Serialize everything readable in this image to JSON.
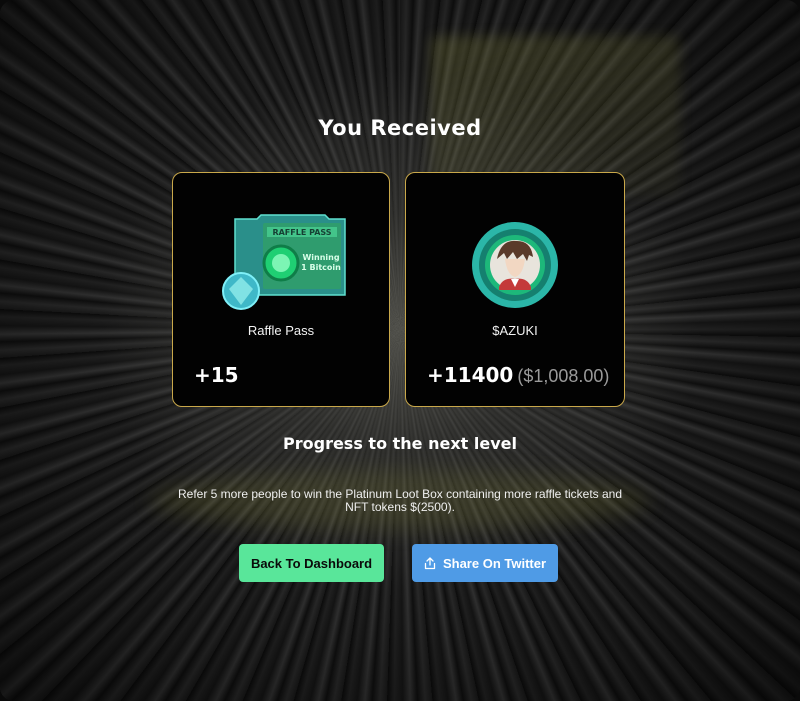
{
  "modal": {
    "title": "You Received"
  },
  "rewards": [
    {
      "icon": "raffle-pass-ticket",
      "ticket_text": {
        "heading": "RAFFLE PASS",
        "line1": "Winning",
        "line2": "1 Bitcoin"
      },
      "label": "Raffle Pass",
      "amount": "+15"
    },
    {
      "icon": "azuki-coin-avatar",
      "label": "$AZUKI",
      "amount": "+11400",
      "usd_value": "($1,008.00)"
    }
  ],
  "progress": {
    "title": "Progress to the next level",
    "description": "Refer 5 more people to win the Platinum Loot Box containing more raffle tickets and NFT tokens $(2500)."
  },
  "buttons": {
    "dashboard_label": "Back To Dashboard",
    "twitter_label": "Share On Twitter",
    "twitter_icon": "share-icon"
  },
  "colors": {
    "card_border": "#c9a84a",
    "dashboard_button": "#59e69a",
    "twitter_button": "#4f9be6",
    "accent_green": "#2ed87a"
  }
}
